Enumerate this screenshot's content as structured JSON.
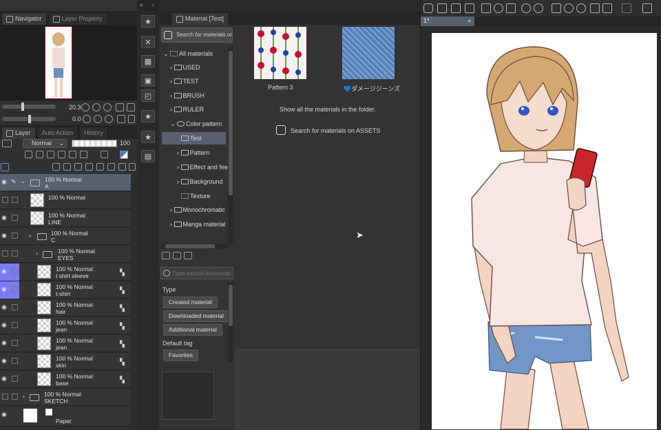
{
  "left_panel": {
    "tabs": [
      "Navigator",
      "Layer Property"
    ],
    "zoom_value": "20.3",
    "rotate_value": "0.0",
    "layer_tabs": [
      "Layer",
      "Auto Action",
      "History"
    ],
    "blend_mode": "Normal",
    "opacity": "100",
    "layers": [
      {
        "line1": "100 % Normal",
        "line2": "A"
      },
      {
        "line1": "100 % Normal",
        "line2": ""
      },
      {
        "line1": "100 % Normal",
        "line2": "LINE"
      },
      {
        "line1": "100 % Normal",
        "line2": "C"
      },
      {
        "line1": "100 % Normal",
        "line2": "EYES"
      },
      {
        "line1": "100 % Normal",
        "line2": "t shirt sleeve"
      },
      {
        "line1": "100 % Normal",
        "line2": "t-shirt"
      },
      {
        "line1": "100 % Normal",
        "line2": "hair"
      },
      {
        "line1": "100 % Normal",
        "line2": "jean"
      },
      {
        "line1": "100 % Normal",
        "line2": "jean"
      },
      {
        "line1": "100 % Normal",
        "line2": "skin"
      },
      {
        "line1": "100 % Normal",
        "line2": "base"
      },
      {
        "line1": "100 % Normal",
        "line2": "SKETCH"
      },
      {
        "line1": "",
        "line2": "Paper"
      }
    ]
  },
  "material_panel": {
    "tab_title": "Material [Test]",
    "search_assets_button": "Search for materials on ASSETS",
    "tree": [
      {
        "label": "All materials"
      },
      {
        "label": "USED"
      },
      {
        "label": "TEST"
      },
      {
        "label": "BRUSH"
      },
      {
        "label": "RULER"
      },
      {
        "label": "Color pattern"
      },
      {
        "label": "Test"
      },
      {
        "label": "Pattern"
      },
      {
        "label": "Effect and fee"
      },
      {
        "label": "Background"
      },
      {
        "label": "Texture"
      },
      {
        "label": "Monochromatic"
      },
      {
        "label": "Manga material"
      }
    ],
    "search_placeholder": "Type search keywords",
    "type_label": "Type",
    "type_buttons": [
      "Created material",
      "Downloaded material",
      "Additional material"
    ],
    "default_tag_label": "Default tag",
    "tag_buttons": [
      "Favorites"
    ],
    "materials": [
      {
        "name": "Pattern 3"
      },
      {
        "name": "💙ダメージジーンズ"
      }
    ],
    "folder_note": "Show all the materials in the folder.",
    "assets_link": "Search for materials on ASSETS"
  },
  "canvas": {
    "tab_label": "1*"
  },
  "colors": {
    "selected_row": "#586070",
    "highlight_blue": "#7b7bff",
    "panel_bg": "#333333"
  }
}
